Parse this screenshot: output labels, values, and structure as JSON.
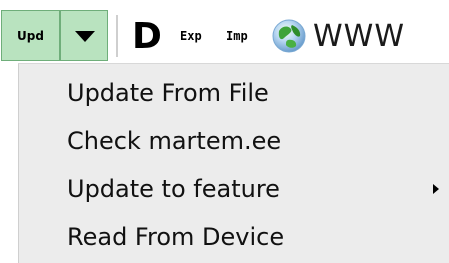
{
  "toolbar": {
    "upd_label": "Upd",
    "d_label": "D",
    "exp_label": "Exp",
    "imp_label": "Imp",
    "www_label": "WWW",
    "accent_color": "#b9e3bf"
  },
  "menu": {
    "items": [
      {
        "label": "Update From File"
      },
      {
        "label": "Check martem.ee"
      },
      {
        "label": "Update to feature",
        "has_submenu": true
      },
      {
        "label": "Read From Device"
      }
    ]
  },
  "icons": {
    "dropdown": "triangle-down-icon",
    "www": "globe-icon",
    "submenu": "chevron-right-icon"
  }
}
